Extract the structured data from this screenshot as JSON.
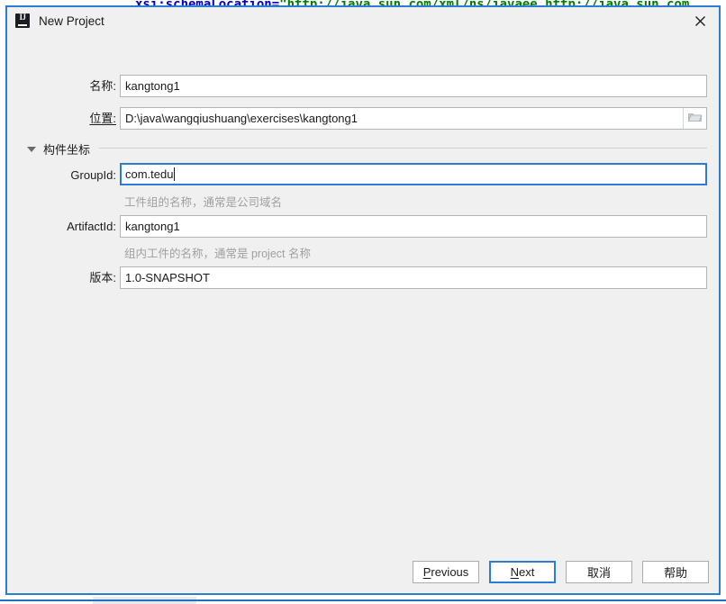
{
  "background": {
    "code_fragment_attr": "xsi:schemaLocation=",
    "code_fragment_str": "\"http://java.sun.com/xml/ns/javaee http://java.sun.com"
  },
  "dialog": {
    "title": "New Project",
    "icon": "intellij-idea-logo",
    "close_icon": "close-icon"
  },
  "form": {
    "name": {
      "label": "名称:",
      "value": "kangtong1"
    },
    "location": {
      "label": "位置:",
      "value": "D:\\java\\wangqiushuang\\exercises\\kangtong1",
      "browse_icon": "folder-icon"
    },
    "section": {
      "label": "构件坐标",
      "expanded": true,
      "arrow_icon": "chevron-down-icon"
    },
    "group_id": {
      "label": "GroupId:",
      "value": "com.tedu",
      "hint": "工件组的名称，通常是公司域名",
      "focused": true
    },
    "artifact_id": {
      "label": "ArtifactId:",
      "value": "kangtong1",
      "hint": "组内工件的名称，通常是 project 名称"
    },
    "version": {
      "label": "版本:",
      "value": "1.0-SNAPSHOT"
    }
  },
  "buttons": {
    "previous": {
      "pre": "",
      "mn": "P",
      "post": "revious"
    },
    "next": {
      "pre": "",
      "mn": "N",
      "post": "ext"
    },
    "cancel": {
      "label": "取消"
    },
    "help": {
      "label": "帮助"
    }
  },
  "colors": {
    "accent": "#2b7cd3",
    "dialog_bg": "#f0f0f0",
    "field_border": "#b4b4b4",
    "hint_text": "#a0a0a0",
    "code_attr": "#0000cc",
    "code_string": "#008000"
  }
}
